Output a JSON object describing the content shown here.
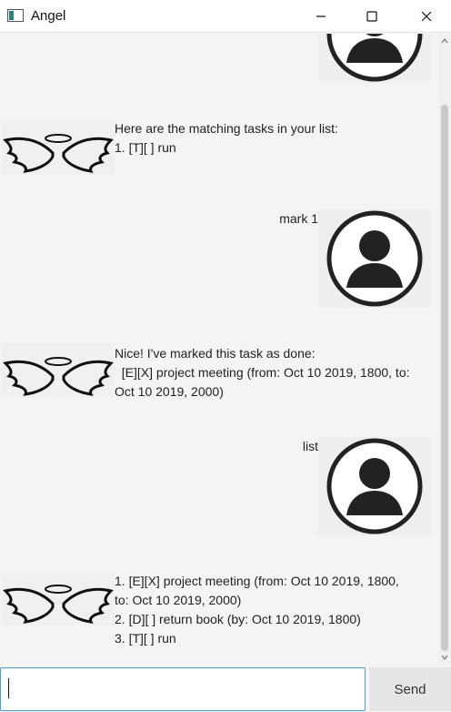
{
  "window": {
    "title": "Angel"
  },
  "messages": [
    {
      "sender": "user",
      "text": ""
    },
    {
      "sender": "bot",
      "text": "Here are the matching tasks in your list:\n1. [T][ ] run"
    },
    {
      "sender": "user",
      "text": "mark 1"
    },
    {
      "sender": "bot",
      "text": "Nice! I've marked this task as done:\n  [E][X] project meeting (from: Oct 10 2019, 1800, to:\nOct 10 2019, 2000)"
    },
    {
      "sender": "user",
      "text": "list"
    },
    {
      "sender": "bot",
      "text": "1. [E][X] project meeting (from: Oct 10 2019, 1800,\nto: Oct 10 2019, 2000)\n2. [D][ ] return book (by: Oct 10 2019, 1800)\n3. [T][ ] run"
    }
  ],
  "input": {
    "value": "",
    "send_label": "Send"
  },
  "colors": {
    "accent": "#4a9fd8",
    "avatar_dark": "#222222"
  }
}
